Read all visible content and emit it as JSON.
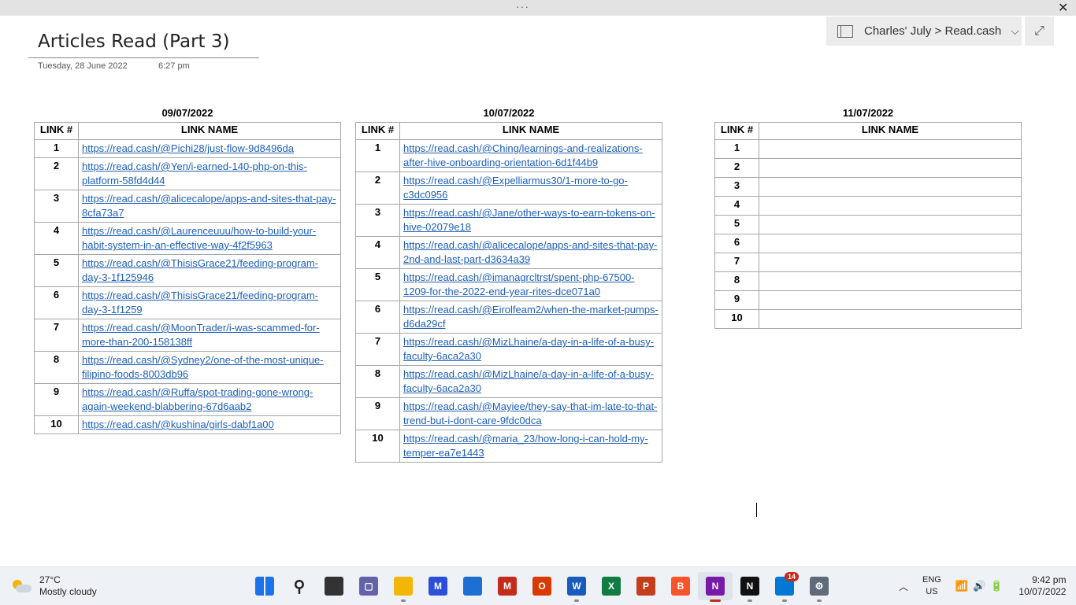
{
  "window": {
    "dots": "···",
    "close": "✕",
    "notebook_path": "Charles' July > Read.cash",
    "chevron": "⌵",
    "expand": "⤢"
  },
  "page": {
    "title": "Articles Read (Part 3)",
    "date": "Tuesday, 28 June 2022",
    "time": "6:27 pm"
  },
  "tables": [
    {
      "date": "09/07/2022",
      "col_num": "LINK #",
      "col_name": "LINK NAME",
      "rows": [
        {
          "n": "1",
          "link": "https://read.cash/@Pichi28/just-flow-9d8496da"
        },
        {
          "n": "2",
          "link": "https://read.cash/@Yen/i-earned-140-php-on-this-platform-58fd4d44"
        },
        {
          "n": "3",
          "link": "https://read.cash/@alicecalope/apps-and-sites-that-pay-8cfa73a7"
        },
        {
          "n": "4",
          "link": "https://read.cash/@Laurenceuuu/how-to-build-your-habit-system-in-an-effective-way-4f2f5963"
        },
        {
          "n": "5",
          "link": "https://read.cash/@ThisisGrace21/feeding-program-day-3-1f125946"
        },
        {
          "n": "6",
          "link": "https://read.cash/@ThisisGrace21/feeding-program-day-3-1f1259"
        },
        {
          "n": "7",
          "link": "https://read.cash/@MoonTrader/i-was-scammed-for-more-than-200-158138ff"
        },
        {
          "n": "8",
          "link": "https://read.cash/@Sydney2/one-of-the-most-unique-filipino-foods-8003db96"
        },
        {
          "n": "9",
          "link": "https://read.cash/@Ruffa/spot-trading-gone-wrong-again-weekend-blabbering-67d6aab2"
        },
        {
          "n": "10",
          "link": "https://read.cash/@kushina/girls-dabf1a00"
        }
      ]
    },
    {
      "date": "10/07/2022",
      "col_num": "LINK #",
      "col_name": "LINK NAME",
      "rows": [
        {
          "n": "1",
          "link": "https://read.cash/@Ching/learnings-and-realizations-after-hive-onboarding-orientation-6d1f44b9"
        },
        {
          "n": "2",
          "link": "https://read.cash/@Expelliarmus30/1-more-to-go-c3dc0956"
        },
        {
          "n": "3",
          "link": "https://read.cash/@Jane/other-ways-to-earn-tokens-on-hive-02079e18"
        },
        {
          "n": "4",
          "link": "https://read.cash/@alicecalope/apps-and-sites-that-pay-2nd-and-last-part-d3634a39"
        },
        {
          "n": "5",
          "link": "https://read.cash/@imanagrcltrst/spent-php-67500-1209-for-the-2022-end-year-rites-dce071a0"
        },
        {
          "n": "6",
          "link": "https://read.cash/@Eirolfeam2/when-the-market-pumps-d6da29cf"
        },
        {
          "n": "7",
          "link": "https://read.cash/@MizLhaine/a-day-in-a-life-of-a-busy-faculty-6aca2a30"
        },
        {
          "n": "8",
          "link": "https://read.cash/@MizLhaine/a-day-in-a-life-of-a-busy-faculty-6aca2a30"
        },
        {
          "n": "9",
          "link": "https://read.cash/@Mayiee/they-say-that-im-late-to-that-trend-but-i-dont-care-9fdc0dca"
        },
        {
          "n": "10",
          "link": "https://read.cash/@maria_23/how-long-i-can-hold-my-temper-ea7e1443"
        }
      ]
    },
    {
      "date": "11/07/2022",
      "col_num": "LINK #",
      "col_name": "LINK NAME",
      "rows": [
        {
          "n": "1",
          "link": ""
        },
        {
          "n": "2",
          "link": ""
        },
        {
          "n": "3",
          "link": ""
        },
        {
          "n": "4",
          "link": ""
        },
        {
          "n": "5",
          "link": ""
        },
        {
          "n": "6",
          "link": ""
        },
        {
          "n": "7",
          "link": ""
        },
        {
          "n": "8",
          "link": ""
        },
        {
          "n": "9",
          "link": ""
        },
        {
          "n": "10",
          "link": ""
        }
      ]
    }
  ],
  "taskbar": {
    "weather_temp": "27°C",
    "weather_desc": "Mostly cloudy",
    "apps": [
      {
        "name": "windows-start-icon",
        "color": "#1a73e8",
        "glyph": ""
      },
      {
        "name": "search-icon",
        "color": "",
        "glyph": "⚲"
      },
      {
        "name": "task-view-icon",
        "color": "#333333",
        "glyph": ""
      },
      {
        "name": "teams-chat-icon",
        "color": "#6264a7",
        "glyph": "▢"
      },
      {
        "name": "file-explorer-icon",
        "color": "#f2b705",
        "glyph": ""
      },
      {
        "name": "app-icon",
        "color": "#2b4fd8",
        "glyph": "M"
      },
      {
        "name": "store-icon",
        "color": "#1d6fd1",
        "glyph": ""
      },
      {
        "name": "mcafee-icon",
        "color": "#c42b1c",
        "glyph": "M"
      },
      {
        "name": "office-icon",
        "color": "#d83b01",
        "glyph": "O"
      },
      {
        "name": "word-icon",
        "color": "#185abd",
        "glyph": "W"
      },
      {
        "name": "excel-icon",
        "color": "#107c41",
        "glyph": "X"
      },
      {
        "name": "powerpoint-icon",
        "color": "#c43e1c",
        "glyph": "P"
      },
      {
        "name": "brave-icon",
        "color": "#fb542b",
        "glyph": "B"
      },
      {
        "name": "onenote-icon",
        "color": "#7719aa",
        "glyph": "N"
      },
      {
        "name": "notion-icon",
        "color": "#111111",
        "glyph": "N"
      },
      {
        "name": "mail-icon",
        "color": "#0078d4",
        "glyph": "",
        "badge": "14"
      },
      {
        "name": "settings-icon",
        "color": "#5f6b7a",
        "glyph": "⚙"
      }
    ],
    "tray_chevron": "︿",
    "lang_1": "ENG",
    "lang_2": "US",
    "sys_icons": "📶🔊🔋",
    "clock_time": "9:42 pm",
    "clock_date": "10/07/2022"
  }
}
